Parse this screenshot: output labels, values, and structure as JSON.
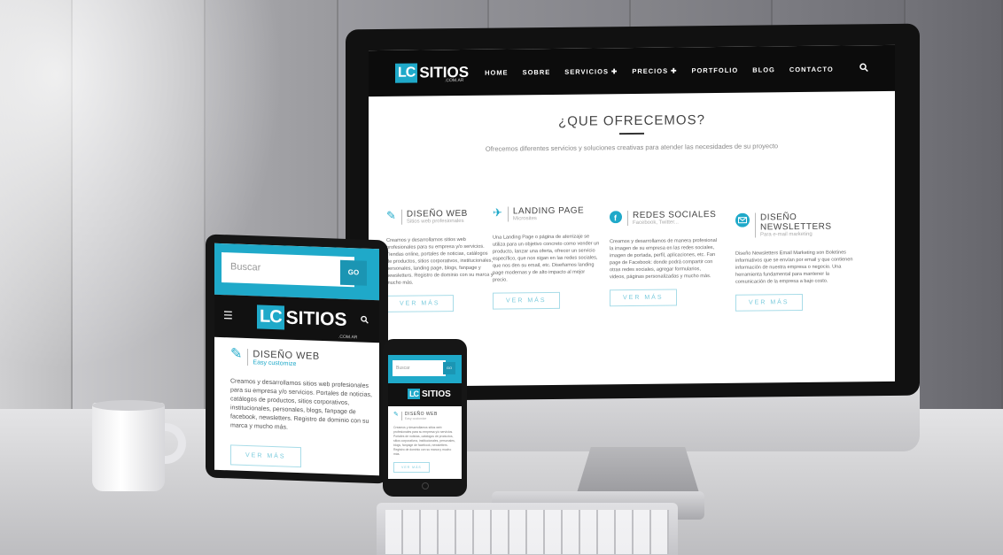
{
  "brand": {
    "logo_mark": "LC",
    "logo_text": "SITIOS",
    "logo_sub": ".COM.AR"
  },
  "desktop": {
    "nav": [
      "HOME",
      "SOBRE",
      "SERVICIOS ✚",
      "PRECIOS ✚",
      "PORTFOLIO",
      "BLOG",
      "CONTACTO"
    ],
    "hero_title": "¿QUE OFRECEMOS?",
    "hero_subtitle": "Ofrecemos diferentes servicios y soluciones creativas para atender las necesidades de su proyecto",
    "services": [
      {
        "title": "DISEÑO WEB",
        "subtitle": "Sitios web profesionales",
        "icon": "pencil-icon",
        "desc": "Creamos y desarrollamos sitios web profesionales para su empresa y/o servicios. Tiendas online, portales de noticias, catálogos de productos, sitios corporativos, institucionales, personales, landing page, blogs, fanpage y newsletters. Registro de dominio con su marca y mucho más.",
        "button": "VER MÁS"
      },
      {
        "title": "LANDING PAGE",
        "subtitle": "Microsites",
        "icon": "plane-icon",
        "desc": "Una Landing Page o página de aterrizaje se utiliza para un objetivo concreto como vender un producto, lanzar una oferta, ofrecer un servicio específico, que nos sigan en las redes sociales, que nos den su email, etc. Diseñamos landing page modernas y de alto impacto al mejor precio.",
        "button": "VER MÁS"
      },
      {
        "title": "REDES SOCIALES",
        "subtitle": "Facebook, Twitter...",
        "icon": "facebook-icon",
        "desc": "Creamos y desarrollamos de manera profesional la imagen de su empresa en las redes sociales, imagen de portada, perfil, aplicaciones, etc. Fan page de Facebook: donde podrá compartir con otras redes sociales, agregar formularios, videos, páginas personalizadas y mucho más.",
        "button": "VER MÁS"
      },
      {
        "title": "DISEÑO NEWSLETTERS",
        "subtitle": "Para e-mail marketing",
        "icon": "email-icon",
        "desc": "Diseño Newsletters Email Marketing son Boletines informativos que se envían por email y que contienen información de nuestra empresa o negocio. Una herramienta fundamental para mantener la comunicación de la empresa a bajo costo.",
        "button": "VER MÁS"
      }
    ]
  },
  "tablet": {
    "search_placeholder": "Buscar",
    "go": "GO",
    "service_title": "DISEÑO WEB",
    "service_subtitle": "Easy customize",
    "desc": "Creamos y desarrollamos sitios web profesionales para su empresa y/o servicios. Portales de noticias, catálogos de productos, sitios corporativos, institucionales, personales, blogs, fanpage de facebook, newsletters. Registro de dominio con su marca y mucho más.",
    "button": "VER MÁS"
  },
  "phone": {
    "search_placeholder": "Buscar",
    "go": "GO",
    "service_title": "DISEÑO WEB",
    "service_subtitle": "Easy customize",
    "desc": "Creamos y desarrollamos sitios web profesionales para su empresa y/o servicios. Portales de noticias, catálogos de productos, sitios corporativos, institucionales, personales, blogs, fanpage de facebook, newsletters. Registro de dominio con su marca y mucho más.",
    "button": "VER MÁS"
  },
  "colors": {
    "accent": "#1fa9c9",
    "nav_bg": "#0c0c0c",
    "button_border": "#a8dce8"
  }
}
